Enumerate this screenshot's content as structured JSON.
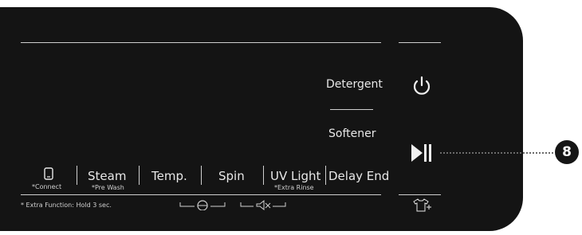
{
  "panel": {
    "detergent_label": "Detergent",
    "softener_label": "Softener",
    "buttons": [
      {
        "label": "",
        "sub": "*Connect"
      },
      {
        "label": "Steam",
        "sub": "*Pre Wash"
      },
      {
        "label": "Temp.",
        "sub": ""
      },
      {
        "label": "Spin",
        "sub": ""
      },
      {
        "label": "UV Light",
        "sub": "*Extra Rinse"
      },
      {
        "label": "Delay End",
        "sub": ""
      }
    ],
    "footnote": "* Extra Function: Hold 3 sec.",
    "icons": {
      "phone": "phone-icon",
      "power": "power-icon",
      "play_pause": "play-pause-icon",
      "child_lock": "child-lock-icon",
      "mute": "mute-icon",
      "add_garment": "add-garment-icon"
    }
  },
  "callout": {
    "number": "8"
  },
  "colors": {
    "panel": "#141414",
    "text": "#e8e8e8",
    "badge": "#151515"
  }
}
